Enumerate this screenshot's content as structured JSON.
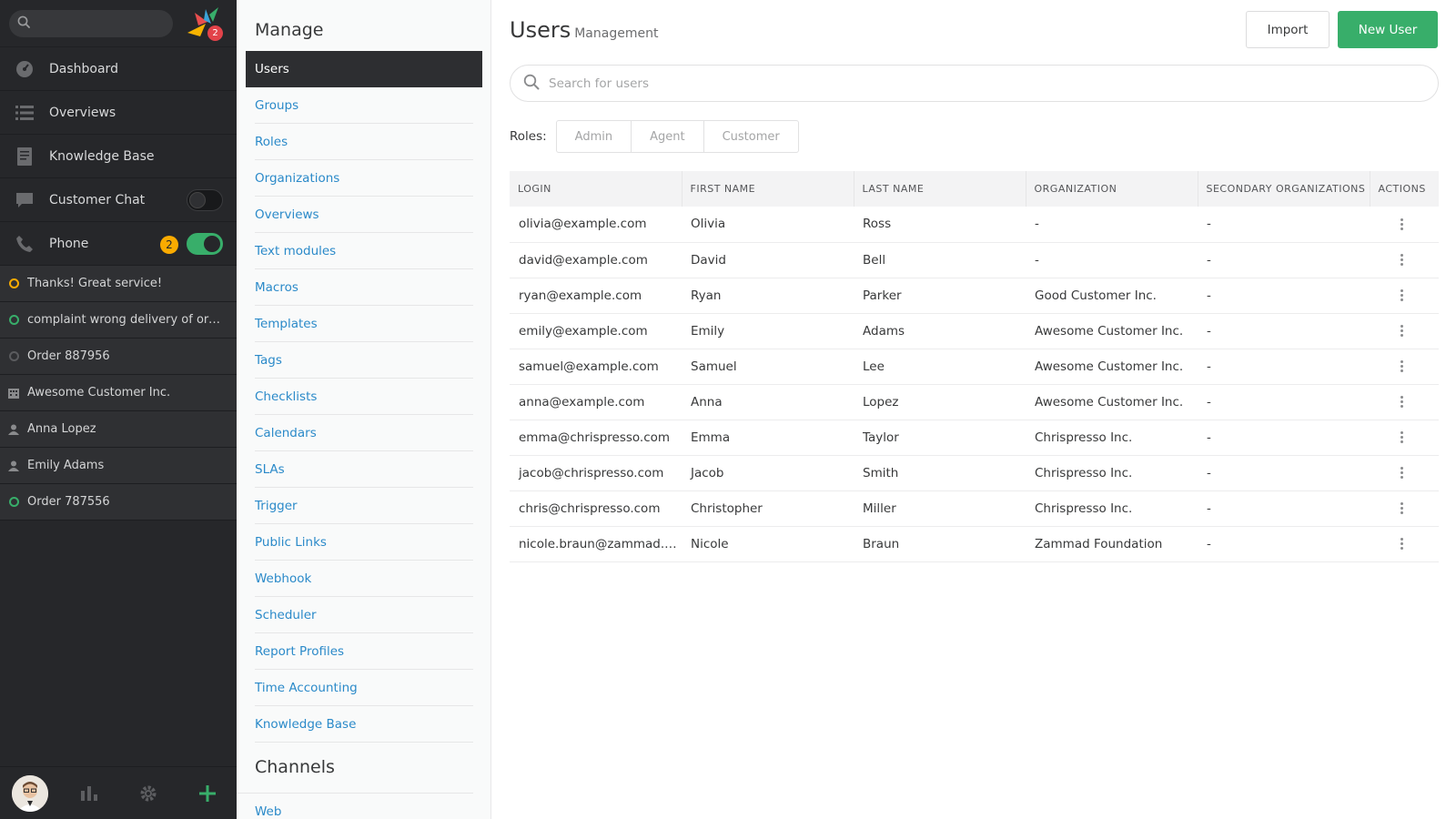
{
  "nav": {
    "search": {
      "placeholder": "",
      "value": ""
    },
    "logo_badge": "2",
    "items": [
      {
        "label": "Dashboard",
        "icon": "dashboard-icon"
      },
      {
        "label": "Overviews",
        "icon": "list-icon"
      },
      {
        "label": "Knowledge Base",
        "icon": "book-icon"
      },
      {
        "label": "Customer Chat",
        "icon": "chat-icon",
        "toggle": false
      },
      {
        "label": "Phone",
        "icon": "phone-icon",
        "badge": "2",
        "toggle": true
      }
    ],
    "tasks": [
      {
        "label": "Thanks! Great service!",
        "icon": "ticket-open-icon",
        "color": "#faab00"
      },
      {
        "label": "complaint wrong delivery of order",
        "icon": "ticket-open-icon",
        "color": "#38ae6a"
      },
      {
        "label": "Order 887956",
        "icon": "ticket-closed-icon",
        "color": "#5a5b5e"
      },
      {
        "label": "Awesome Customer Inc.",
        "icon": "organization-icon",
        "color": "#8a8b8d"
      },
      {
        "label": "Anna Lopez",
        "icon": "user-icon",
        "color": "#8a8b8d"
      },
      {
        "label": "Emily Adams",
        "icon": "user-icon",
        "color": "#8a8b8d"
      },
      {
        "label": "Order 787556",
        "icon": "ticket-open-icon",
        "color": "#38ae6a"
      }
    ]
  },
  "admin_menu": {
    "heading": "Manage",
    "items": [
      "Users",
      "Groups",
      "Roles",
      "Organizations",
      "Overviews",
      "Text modules",
      "Macros",
      "Templates",
      "Tags",
      "Checklists",
      "Calendars",
      "SLAs",
      "Trigger",
      "Public Links",
      "Webhook",
      "Scheduler",
      "Report Profiles",
      "Time Accounting",
      "Knowledge Base"
    ],
    "active": "Users",
    "channels_heading": "Channels",
    "channels_items": [
      "Web"
    ]
  },
  "content": {
    "title": "Users",
    "subtitle": "Management",
    "import_label": "Import",
    "new_user_label": "New User",
    "search_placeholder": "Search for users",
    "roles_label": "Roles:",
    "roles": [
      "Admin",
      "Agent",
      "Customer"
    ],
    "table": {
      "headers": [
        "LOGIN",
        "FIRST NAME",
        "LAST NAME",
        "ORGANIZATION",
        "SECONDARY ORGANIZATIONS",
        "ACTIONS"
      ],
      "rows": [
        [
          "olivia@example.com",
          "Olivia",
          "Ross",
          "-",
          "-"
        ],
        [
          "david@example.com",
          "David",
          "Bell",
          "-",
          "-"
        ],
        [
          "ryan@example.com",
          "Ryan",
          "Parker",
          "Good Customer Inc.",
          "-"
        ],
        [
          "emily@example.com",
          "Emily",
          "Adams",
          "Awesome Customer Inc.",
          "-"
        ],
        [
          "samuel@example.com",
          "Samuel",
          "Lee",
          "Awesome Customer Inc.",
          "-"
        ],
        [
          "anna@example.com",
          "Anna",
          "Lopez",
          "Awesome Customer Inc.",
          "-"
        ],
        [
          "emma@chrispresso.com",
          "Emma",
          "Taylor",
          "Chrispresso Inc.",
          "-"
        ],
        [
          "jacob@chrispresso.com",
          "Jacob",
          "Smith",
          "Chrispresso Inc.",
          "-"
        ],
        [
          "chris@chrispresso.com",
          "Christopher",
          "Miller",
          "Chrispresso Inc.",
          "-"
        ],
        [
          "nicole.braun@zammad.org",
          "Nicole",
          "Braun",
          "Zammad Foundation",
          "-"
        ]
      ]
    }
  },
  "colors": {
    "accent_green": "#38ae6a",
    "link_blue": "#2b8ac9",
    "nav_dark": "#26272a",
    "warning_yellow": "#faab00",
    "badge_red": "#e2434a"
  }
}
